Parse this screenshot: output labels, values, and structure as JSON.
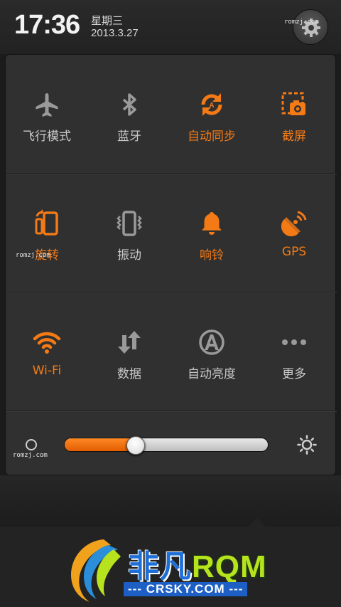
{
  "status": {
    "time": "17:36",
    "weekday": "星期三",
    "date": "2013.3.27"
  },
  "watermark": "romzj.com",
  "toggles": [
    {
      "label": "飞行模式",
      "icon": "airplane-icon",
      "on": false
    },
    {
      "label": "蓝牙",
      "icon": "bluetooth-icon",
      "on": false
    },
    {
      "label": "自动同步",
      "icon": "sync-icon",
      "on": true
    },
    {
      "label": "截屏",
      "icon": "screenshot-icon",
      "on": true
    },
    {
      "label": "旋转",
      "icon": "rotate-icon",
      "on": true
    },
    {
      "label": "振动",
      "icon": "vibrate-icon",
      "on": false
    },
    {
      "label": "响铃",
      "icon": "bell-icon",
      "on": true
    },
    {
      "label": "GPS",
      "icon": "gps-icon",
      "on": true
    },
    {
      "label": "Wi-Fi",
      "icon": "wifi-icon",
      "on": true
    },
    {
      "label": "数据",
      "icon": "data-icon",
      "on": false
    },
    {
      "label": "自动亮度",
      "icon": "auto-brightness-icon",
      "on": false
    },
    {
      "label": "更多",
      "icon": "more-icon",
      "on": false
    }
  ],
  "brightness": {
    "level": 0.35
  },
  "logo": {
    "title_cn": "非凡",
    "title_en": "RQM",
    "subtitle": "--- CRSKY.COM ---"
  },
  "colors": {
    "accent": "#f47a16",
    "off": "#c9c9c9",
    "panel": "#303030"
  }
}
